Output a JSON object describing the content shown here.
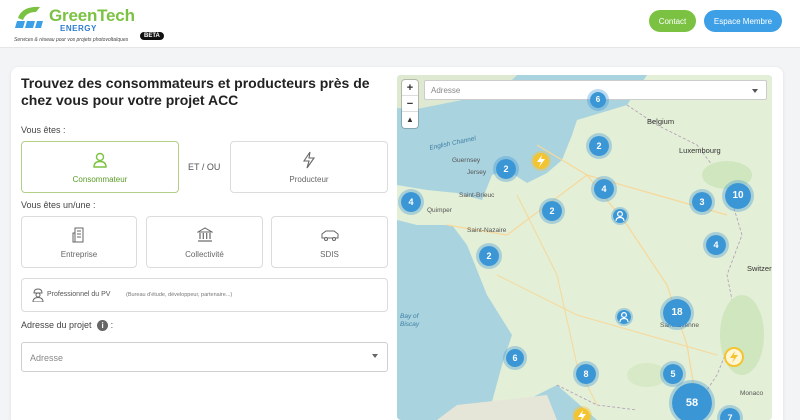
{
  "header": {
    "brand": "GreenTech",
    "brand_sub": "ENERGY",
    "tagline": "Services & réseau pour vos projets photovoltaïques",
    "beta": "BETA",
    "contact_label": "Contact",
    "member_label": "Espace Membre"
  },
  "form": {
    "title": "Trouvez des consommateurs et producteurs près de chez vous pour votre projet ACC",
    "vous_etes_label": "Vous êtes :",
    "role_consumer": "Consommateur",
    "role_connector": "ET / OU",
    "role_producer": "Producteur",
    "vous_etes_type_label": "Vous êtes un/une :",
    "type_company": "Entreprise",
    "type_community": "Collectivité",
    "type_sdis": "SDIS",
    "pro_label": "Professionnel du PV",
    "pro_hint": "(Bureau d'étude, développeur, partenaire...)",
    "address_label": "Adresse du projet",
    "address_info_icon": "i",
    "address_placeholder": "Adresse"
  },
  "map": {
    "search_placeholder": "Adresse",
    "zoom_in": "+",
    "zoom_out": "−",
    "reset": "▲",
    "sea_english_channel": "English Channel",
    "sea_bay": "Bay of Biscay",
    "places": {
      "belgium": "Belgium",
      "luxembourg": "Luxembourg",
      "guernsey": "Guernsey",
      "jersey": "Jersey",
      "switzerland": "Switzerland",
      "monaco": "Monaco",
      "saint_brieuc": "Saint-Brieuc",
      "quimper": "Quimper",
      "saint_nazaire": "Saint-Nazaire",
      "saint_etienne": "Saint-Étienne"
    },
    "clusters": [
      "6",
      "2",
      "2",
      "4",
      "4",
      "2",
      "3",
      "10",
      "2",
      "4",
      "18",
      "6",
      "8",
      "5",
      "58",
      "7"
    ]
  },
  "colors": {
    "brand_green": "#7cc242",
    "brand_blue": "#3da0e6",
    "cluster_blue": "#3b96d6",
    "producer_yellow": "#f4c430"
  }
}
